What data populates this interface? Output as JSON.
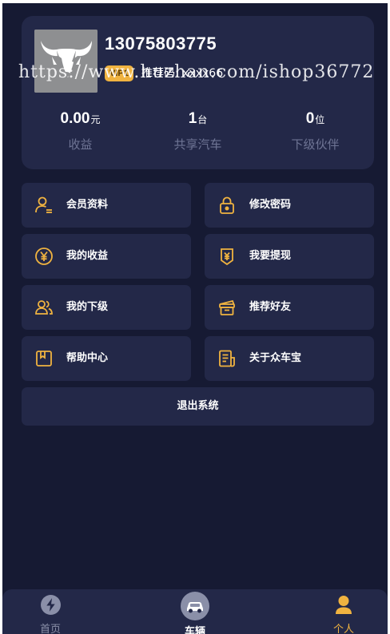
{
  "profile": {
    "phone": "13075803775",
    "vip_badge": "VIP1",
    "referrer": "推荐码: xxxx66",
    "watermark": "https://www.huzhan.com/ishop36772"
  },
  "stats": [
    {
      "value": "0.00",
      "unit": "元",
      "label": "收益"
    },
    {
      "value": "1",
      "unit": "台",
      "label": "共享汽车"
    },
    {
      "value": "0",
      "unit": "位",
      "label": "下级伙伴"
    }
  ],
  "menu": [
    {
      "label": "会员资料",
      "icon": "user-icon"
    },
    {
      "label": "修改密码",
      "icon": "lock-icon"
    },
    {
      "label": "我的收益",
      "icon": "yen-coin-icon"
    },
    {
      "label": "我要提现",
      "icon": "withdraw-icon"
    },
    {
      "label": "我的下级",
      "icon": "users-icon"
    },
    {
      "label": "推荐好友",
      "icon": "gift-icon"
    },
    {
      "label": "帮助中心",
      "icon": "help-book-icon"
    },
    {
      "label": "关于众车宝",
      "icon": "document-icon"
    }
  ],
  "logout_label": "退出系统",
  "tabs": [
    {
      "label": "首页",
      "icon": "lightning-icon"
    },
    {
      "label": "车辆",
      "icon": "car-icon"
    },
    {
      "label": "个人",
      "icon": "person-icon"
    }
  ],
  "colors": {
    "background": "#161a33",
    "card": "#232848",
    "accent": "#f0b340",
    "muted": "#6f7595"
  }
}
